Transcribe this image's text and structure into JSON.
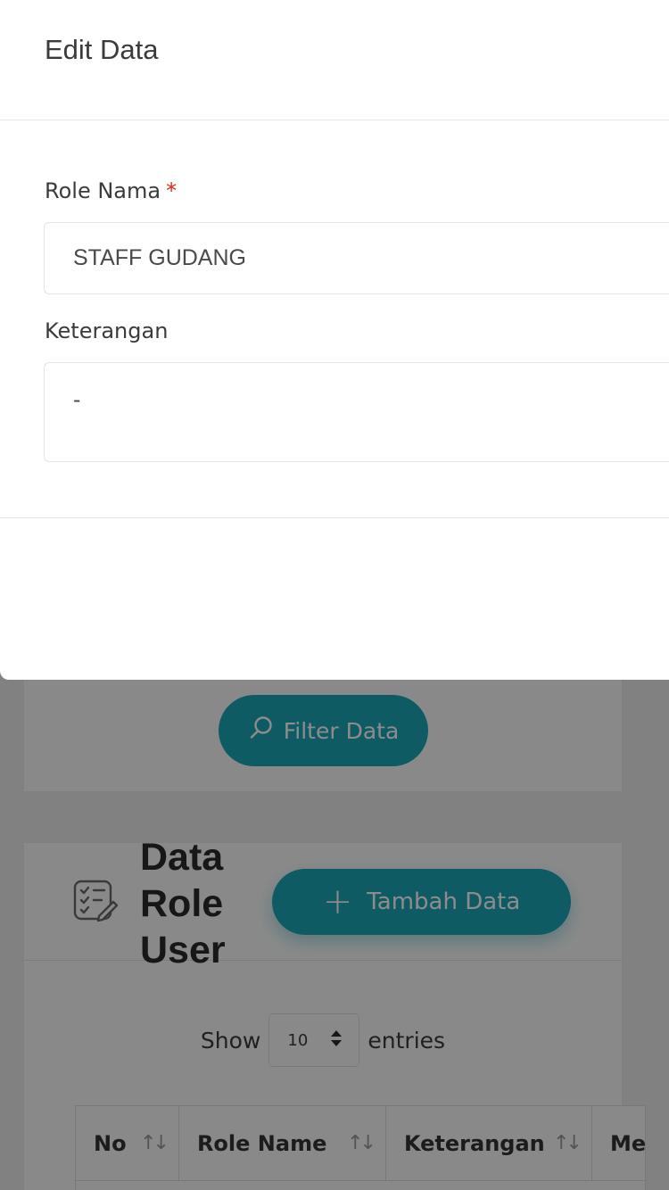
{
  "modal": {
    "title": "Edit Data",
    "fields": {
      "role_name": {
        "label": "Role Nama",
        "required_mark": "*",
        "value": "STAFF GUDANG"
      },
      "description": {
        "label": "Keterangan",
        "value": "-"
      }
    }
  },
  "filter": {
    "button_label": "Filter Data",
    "icon": "search-icon"
  },
  "data_card": {
    "title": "Data Role User",
    "icon": "checklist-edit-icon",
    "add_button_label": "Tambah Data",
    "show_label": "Show",
    "entries_value": "10",
    "entries_label": "entries"
  },
  "table": {
    "columns": [
      "No",
      "Role Name",
      "Keterangan",
      "Menu"
    ],
    "sort_icon": "sort-icon"
  },
  "colors": {
    "accent": "#1aa7b4",
    "required": "#e02424"
  }
}
